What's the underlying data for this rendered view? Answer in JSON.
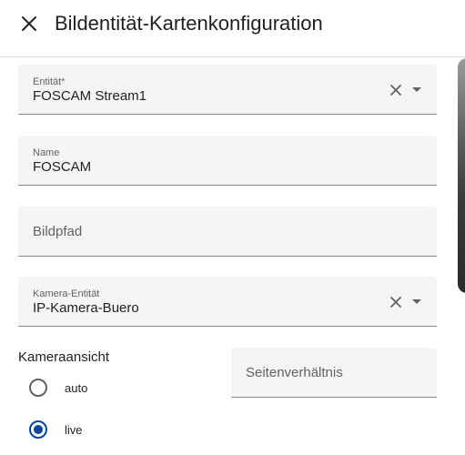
{
  "dialog": {
    "title": "Bildentität-Kartenkonfiguration",
    "close_icon": "close-icon"
  },
  "fields": {
    "entity": {
      "label": "Entität*",
      "value": "FOSCAM Stream1"
    },
    "name": {
      "label": "Name",
      "value": "FOSCAM"
    },
    "image_path": {
      "label": "Bildpfad",
      "value": ""
    },
    "camera_entity": {
      "label": "Kamera-Entität",
      "value": "IP-Kamera-Buero"
    },
    "aspect_ratio": {
      "label": "Seitenverhältnis",
      "value": ""
    }
  },
  "camera_view": {
    "label": "Kameraansicht",
    "options": [
      {
        "label": "auto",
        "checked": false
      },
      {
        "label": "live",
        "checked": true
      }
    ]
  },
  "colors": {
    "accent": "#03469c",
    "field_bg": "#f5f5f5"
  }
}
